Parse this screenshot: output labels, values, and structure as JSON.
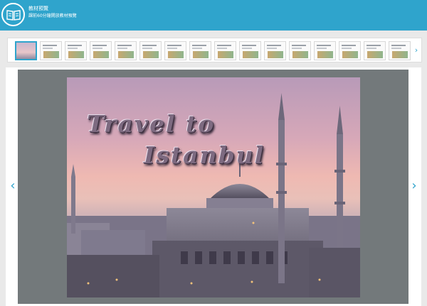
{
  "header": {
    "title": "教材預覽",
    "subtitle": "課前60分鐘開放教材預覽",
    "logo_icon": "open-book-icon",
    "bg_color": "#2fa4cc"
  },
  "thumbnails": {
    "count": 16,
    "active_index": 0,
    "next_icon": "chevron-right-icon",
    "next_symbol": "›"
  },
  "slide": {
    "title_line1": "Travel to",
    "title_line2": "Istanbul",
    "image_subject": "mosque-skyline-at-sunset"
  },
  "nav": {
    "prev_symbol": "‹",
    "next_symbol": "›",
    "prev_icon": "chevron-left-icon",
    "next_icon": "chevron-right-icon"
  }
}
